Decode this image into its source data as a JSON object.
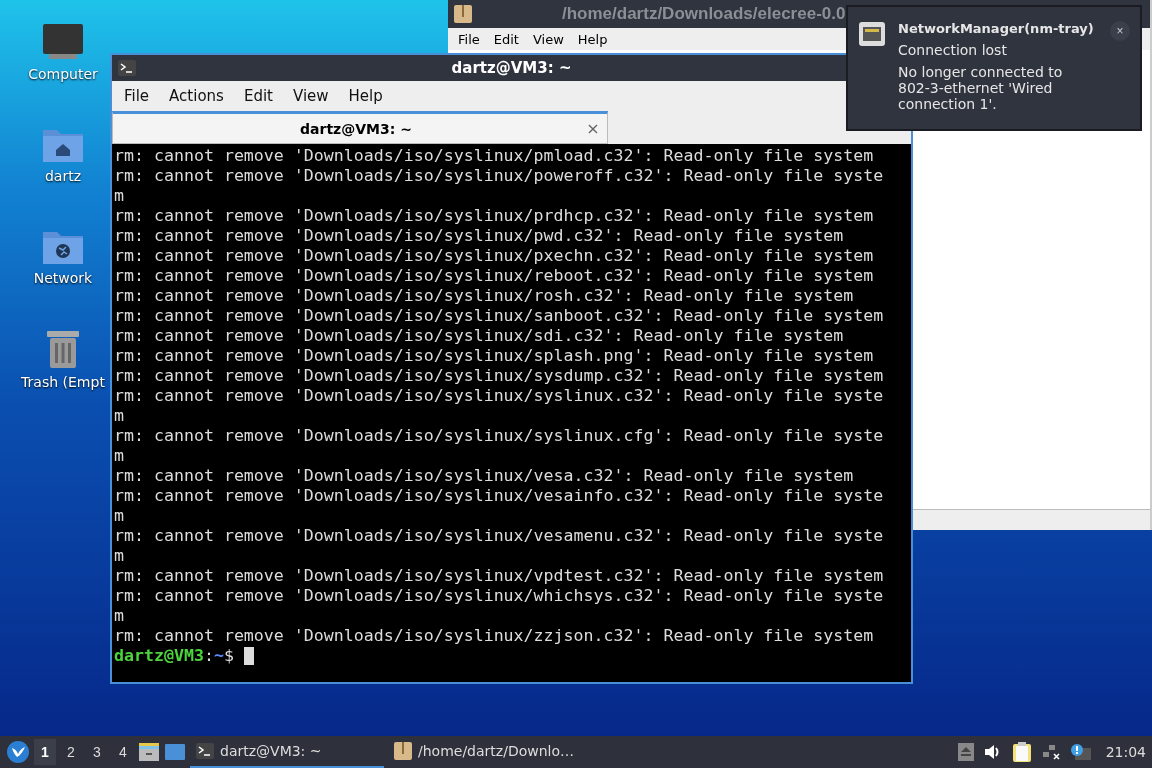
{
  "desktop_icons": [
    {
      "kind": "computer",
      "label": "Computer"
    },
    {
      "kind": "home",
      "label": "dartz"
    },
    {
      "kind": "network",
      "label": "Network"
    },
    {
      "kind": "trash",
      "label": "Trash (Empt"
    }
  ],
  "back_window": {
    "title": "/home/dartz/Downloads/elecree-0.0",
    "menu": [
      "File",
      "Edit",
      "View",
      "Help"
    ]
  },
  "terminal": {
    "title": "dartz@VM3: ~",
    "menu": [
      "File",
      "Actions",
      "Edit",
      "View",
      "Help"
    ],
    "tabs": [
      {
        "label": "dartz@VM3: ~",
        "selected": true,
        "close": "×"
      }
    ],
    "lines": [
      "rm: cannot remove 'Downloads/iso/syslinux/pmload.c32': Read-only file system",
      "rm: cannot remove 'Downloads/iso/syslinux/poweroff.c32': Read-only file syste",
      "m",
      "rm: cannot remove 'Downloads/iso/syslinux/prdhcp.c32': Read-only file system",
      "rm: cannot remove 'Downloads/iso/syslinux/pwd.c32': Read-only file system",
      "rm: cannot remove 'Downloads/iso/syslinux/pxechn.c32': Read-only file system",
      "rm: cannot remove 'Downloads/iso/syslinux/reboot.c32': Read-only file system",
      "rm: cannot remove 'Downloads/iso/syslinux/rosh.c32': Read-only file system",
      "rm: cannot remove 'Downloads/iso/syslinux/sanboot.c32': Read-only file system",
      "rm: cannot remove 'Downloads/iso/syslinux/sdi.c32': Read-only file system",
      "rm: cannot remove 'Downloads/iso/syslinux/splash.png': Read-only file system",
      "rm: cannot remove 'Downloads/iso/syslinux/sysdump.c32': Read-only file system",
      "rm: cannot remove 'Downloads/iso/syslinux/syslinux.c32': Read-only file syste",
      "m",
      "rm: cannot remove 'Downloads/iso/syslinux/syslinux.cfg': Read-only file syste",
      "m",
      "rm: cannot remove 'Downloads/iso/syslinux/vesa.c32': Read-only file system",
      "rm: cannot remove 'Downloads/iso/syslinux/vesainfo.c32': Read-only file syste",
      "m",
      "rm: cannot remove 'Downloads/iso/syslinux/vesamenu.c32': Read-only file syste",
      "m",
      "rm: cannot remove 'Downloads/iso/syslinux/vpdtest.c32': Read-only file system",
      "rm: cannot remove 'Downloads/iso/syslinux/whichsys.c32': Read-only file syste",
      "m",
      "rm: cannot remove 'Downloads/iso/syslinux/zzjson.c32': Read-only file system"
    ],
    "prompt": {
      "user_host": "dartz@VM3",
      "separator": ":",
      "path": "~",
      "symbol": "$"
    }
  },
  "notification": {
    "app": "NetworkManager(nm-tray)",
    "summary": "Connection lost",
    "body": "No longer connected to 802-3-ethernet 'Wired connection 1'.",
    "close": "×"
  },
  "taskbar": {
    "workspaces": [
      {
        "label": "1",
        "selected": true
      },
      {
        "label": "2",
        "selected": false
      },
      {
        "label": "3",
        "selected": false
      },
      {
        "label": "4",
        "selected": false
      }
    ],
    "tasks": [
      {
        "kind": "terminal",
        "label": "dartz@VM3: ~",
        "selected": true
      },
      {
        "kind": "archive",
        "label": "/home/dartz/Downlo…",
        "selected": false
      }
    ],
    "clock": "21:04"
  }
}
